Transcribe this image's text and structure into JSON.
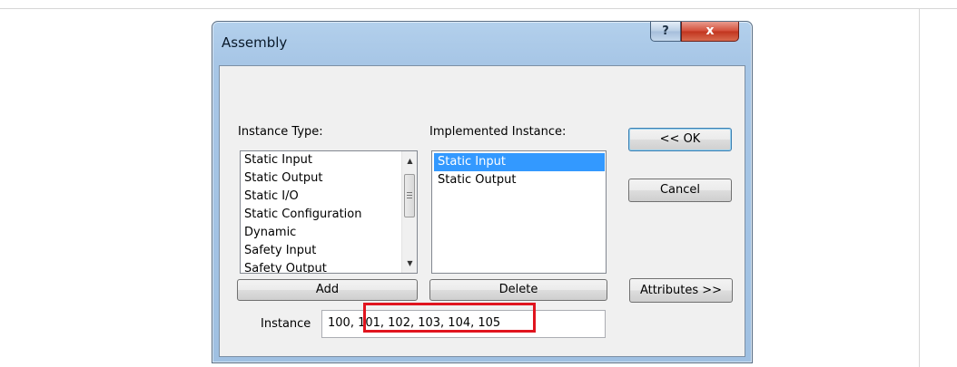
{
  "window": {
    "title": "Assembly",
    "help_label": "?",
    "close_label": "x"
  },
  "instance_type": {
    "label": "Instance Type:",
    "items": [
      "Static Input",
      "Static Output",
      "Static I/O",
      "Static Configuration",
      "Dynamic",
      "Safety Input",
      "Safety Output"
    ]
  },
  "implemented_instance": {
    "label": "Implemented Instance:",
    "items": [
      "Static Input",
      "Static Output"
    ],
    "selected_index": 0
  },
  "buttons": {
    "ok": "<< OK",
    "cancel": "Cancel",
    "attributes": "Attributes >>",
    "add": "Add",
    "delete": "Delete"
  },
  "instance_field": {
    "label": "Instance",
    "value": "100, 101, 102, 103, 104, 105"
  },
  "colors": {
    "selection": "#3399ff",
    "highlight": "#e0141e",
    "close_button": "#c2351f"
  },
  "icons": {
    "scroll_up": "▲",
    "scroll_down": "▼"
  }
}
